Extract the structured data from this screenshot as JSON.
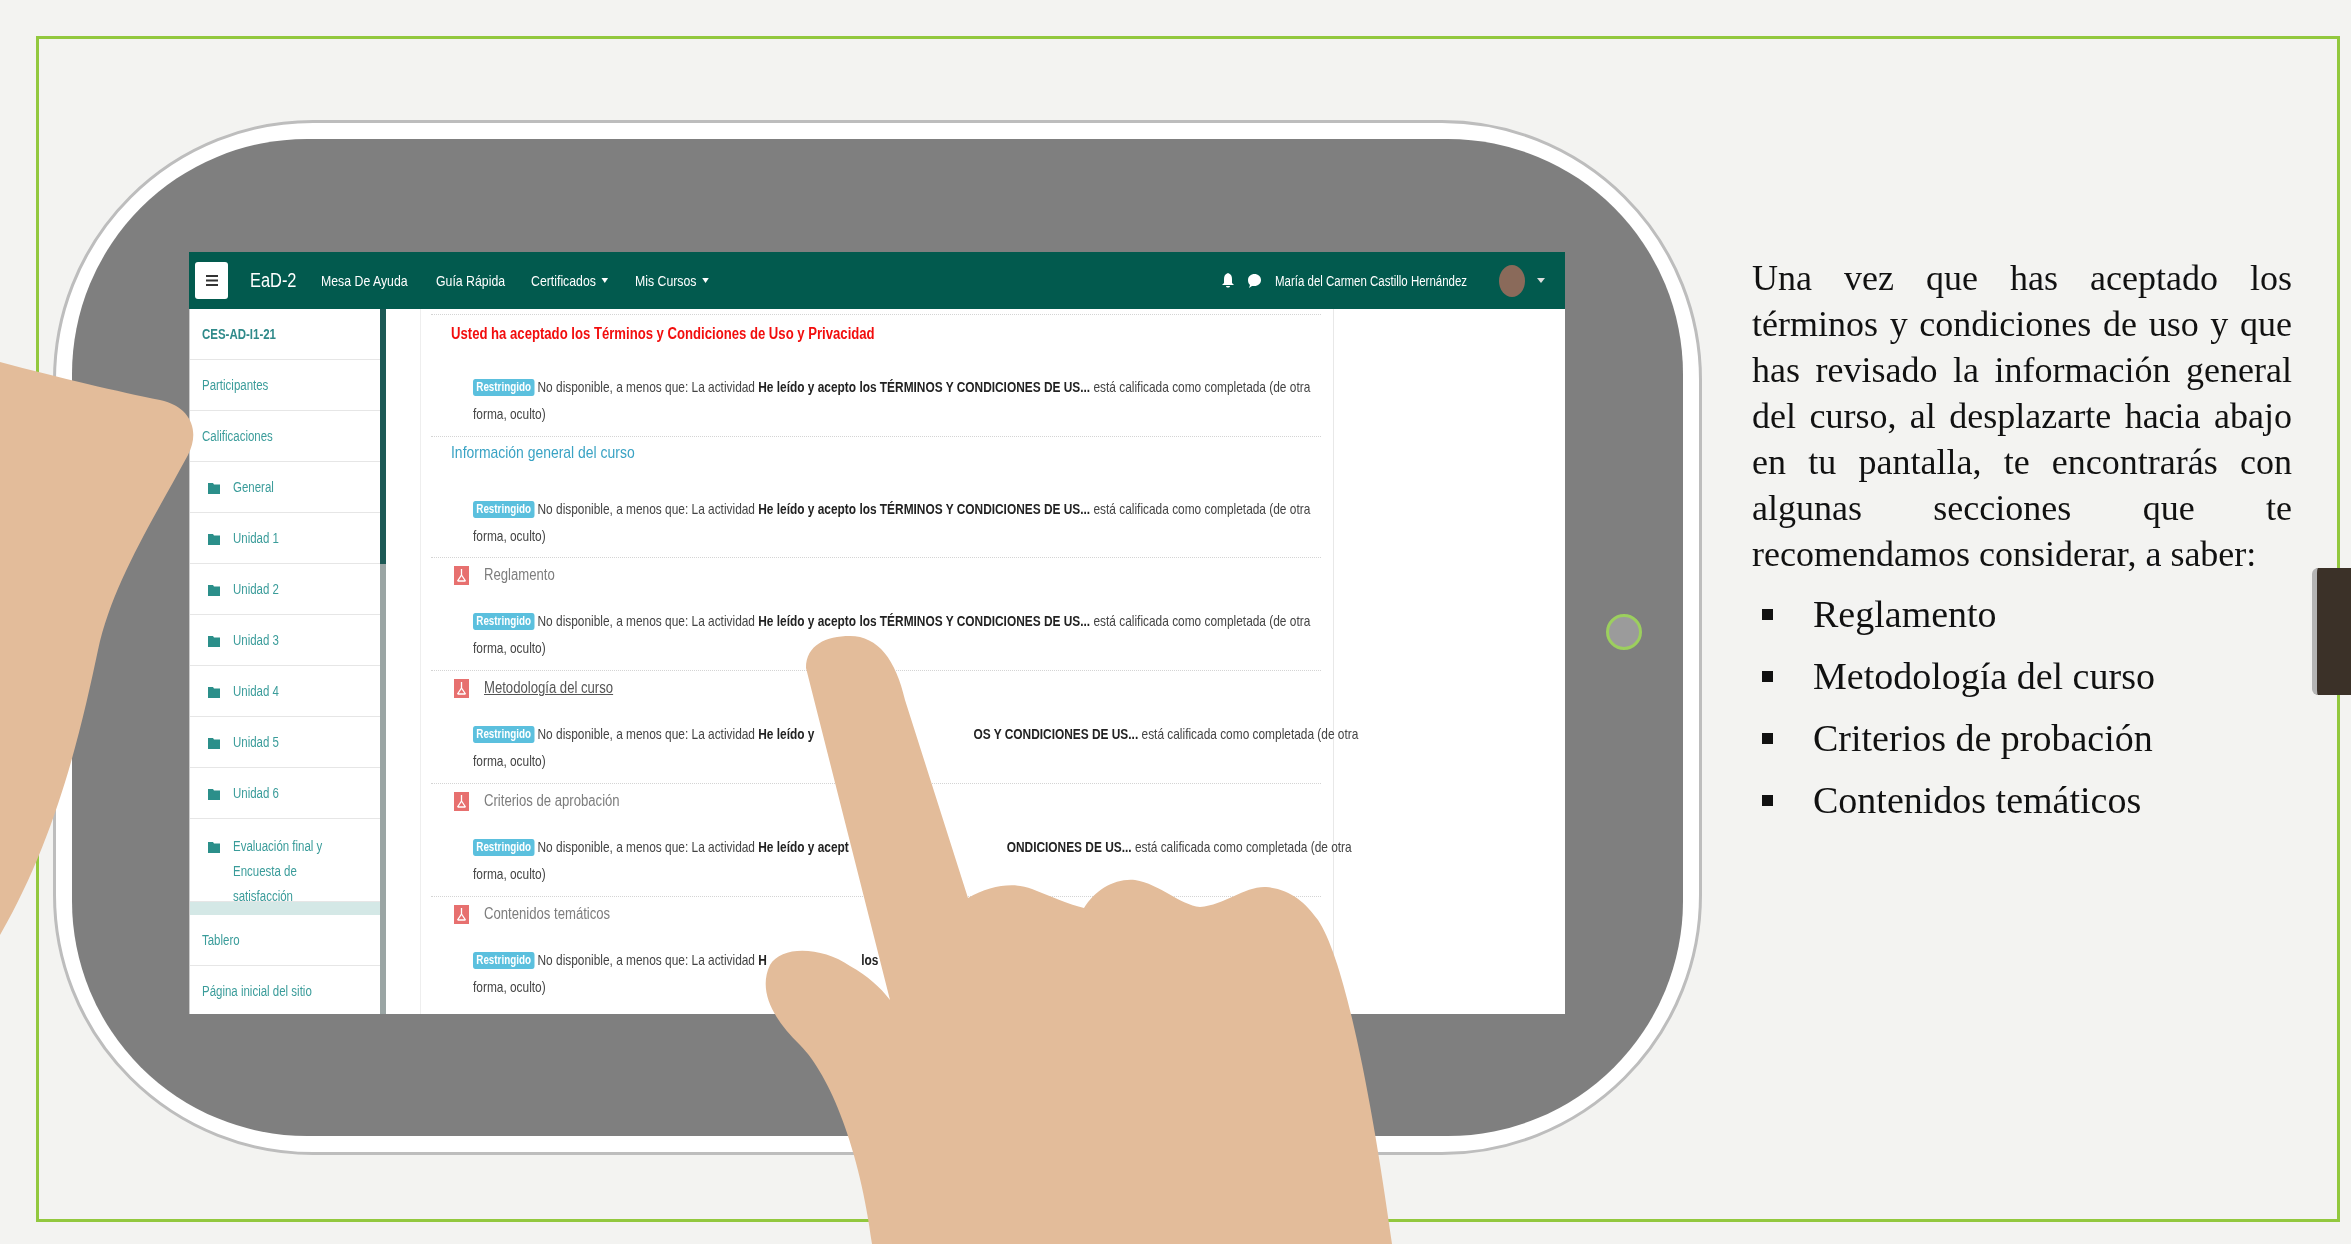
{
  "navbar": {
    "brand": "EaD-2",
    "links": [
      {
        "label": "Mesa De Ayuda",
        "dropdown": false
      },
      {
        "label": "Guía Rápida",
        "dropdown": false
      },
      {
        "label": "Certificados",
        "dropdown": true
      },
      {
        "label": "Mis Cursos",
        "dropdown": true
      }
    ],
    "user": {
      "name": "María del Carmen Castillo Hernández"
    }
  },
  "sidebar": {
    "items": [
      {
        "kind": "course",
        "label": "CES-AD-I1-21"
      },
      {
        "kind": "link",
        "label": "Participantes"
      },
      {
        "kind": "link",
        "label": "Calificaciones"
      },
      {
        "kind": "section",
        "label": "General"
      },
      {
        "kind": "section",
        "label": "Unidad 1"
      },
      {
        "kind": "section",
        "label": "Unidad 2"
      },
      {
        "kind": "section",
        "label": "Unidad 3"
      },
      {
        "kind": "section",
        "label": "Unidad 4"
      },
      {
        "kind": "section",
        "label": "Unidad 5"
      },
      {
        "kind": "section",
        "label": "Unidad 6"
      },
      {
        "kind": "section",
        "label": "Evaluación final y Encuesta de satisfacción"
      },
      {
        "kind": "spacer"
      },
      {
        "kind": "link",
        "label": "Tablero"
      },
      {
        "kind": "link",
        "label": "Página inicial del sitio"
      }
    ]
  },
  "content": {
    "blocks": [
      {
        "kind": "notice",
        "title": "Usted ha aceptado los Términos y Condiciones de Uso y Privacidad",
        "restriction": {
          "kind": "full",
          "badge": "Restringido",
          "head": "No disponible, a menos que: La actividad **He leído y acepto los TÉRMINOS Y CONDICIONES DE US...** está calificada como completada (de otra",
          "end": "forma, oculto)"
        }
      },
      {
        "kind": "section",
        "title": "Información general del curso",
        "restriction": {
          "kind": "full",
          "badge": "Restringido",
          "head": "No disponible, a menos que: La actividad **He leído y acepto los TÉRMINOS Y CONDICIONES DE US...** está calificada como completada (de otra",
          "end": "forma, oculto)"
        }
      },
      {
        "kind": "activity",
        "title": "Reglamento",
        "hover": false,
        "restriction": {
          "kind": "full",
          "badge": "Restringido",
          "head": "No disponible, a menos que: La actividad **He leído y acepto los TÉRMINOS Y CONDICIONES DE US...** está calificada como completada (de otra",
          "end": "forma, oculto)"
        }
      },
      {
        "kind": "activity",
        "title": "Metodología del curso",
        "hover": true,
        "restriction": {
          "kind": "gap",
          "badge": "Restringido",
          "head": "No disponible, a menos que: La actividad **He leído y**",
          "tail": "**OS Y CONDICIONES DE US...** está calificada como completada (de otra",
          "end": "forma, oculto)"
        }
      },
      {
        "kind": "activity",
        "title": "Criterios de aprobación",
        "hover": false,
        "restriction": {
          "kind": "gap",
          "badge": "Restringido",
          "head": "No disponible, a menos que: La actividad **He leído y acept**",
          "tail": "**ONDICIONES DE US...** está calificada como completada (de otra",
          "end": "forma, oculto)"
        }
      },
      {
        "kind": "activity",
        "title": "Contenidos temáticos",
        "hover": false,
        "restriction": {
          "kind": "cut",
          "badge": "Restringido",
          "head": "No disponible, a menos que: La actividad **H**",
          "tail": "**los**",
          "end": "forma, oculto)"
        }
      }
    ]
  },
  "description": {
    "paragraph": "Una vez que has aceptado los términos y condiciones de uso y que has revisado la información general del curso, al desplazarte hacia abajo en tu pantalla, te encontrarás con algunas secciones que te recomendamos considerar, a saber:",
    "bullets": [
      "Reglamento",
      "Metodología del curso",
      "Criterios de probación",
      "Contenidos temáticos"
    ]
  }
}
